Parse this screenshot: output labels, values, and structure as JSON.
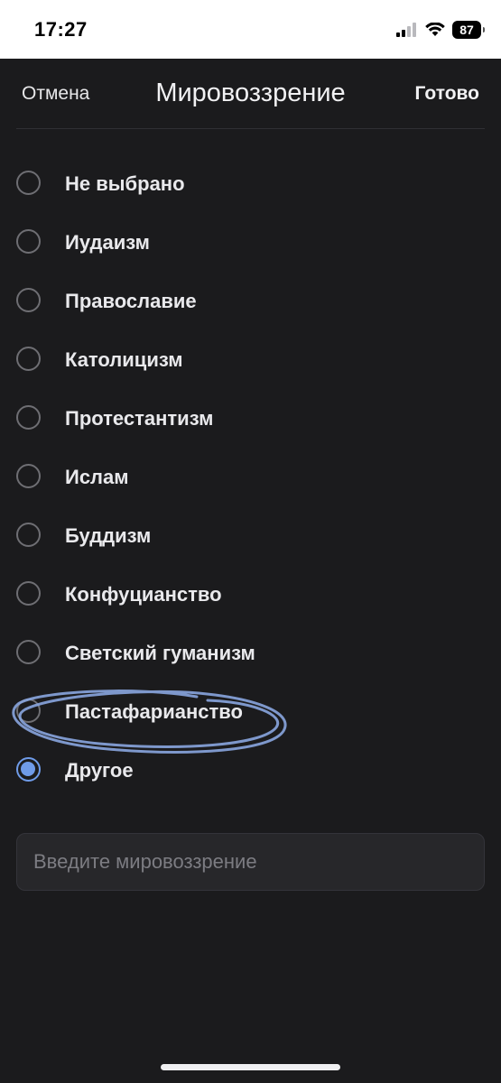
{
  "status_bar": {
    "time": "17:27",
    "battery": "87"
  },
  "nav": {
    "cancel_label": "Отмена",
    "title": "Мировоззрение",
    "done_label": "Готово"
  },
  "options": [
    {
      "label": "Не выбрано",
      "selected": false
    },
    {
      "label": "Иудаизм",
      "selected": false
    },
    {
      "label": "Православие",
      "selected": false
    },
    {
      "label": "Католицизм",
      "selected": false
    },
    {
      "label": "Протестантизм",
      "selected": false
    },
    {
      "label": "Ислам",
      "selected": false
    },
    {
      "label": "Буддизм",
      "selected": false
    },
    {
      "label": "Конфуцианство",
      "selected": false
    },
    {
      "label": "Светский гуманизм",
      "selected": false
    },
    {
      "label": "Пастафарианство",
      "selected": false
    },
    {
      "label": "Другое",
      "selected": true
    }
  ],
  "custom_input": {
    "placeholder": "Введите мировоззрение",
    "value": ""
  },
  "colors": {
    "background": "#1b1b1d",
    "accent": "#6f9be8",
    "annotation": "#8aa6e0"
  }
}
